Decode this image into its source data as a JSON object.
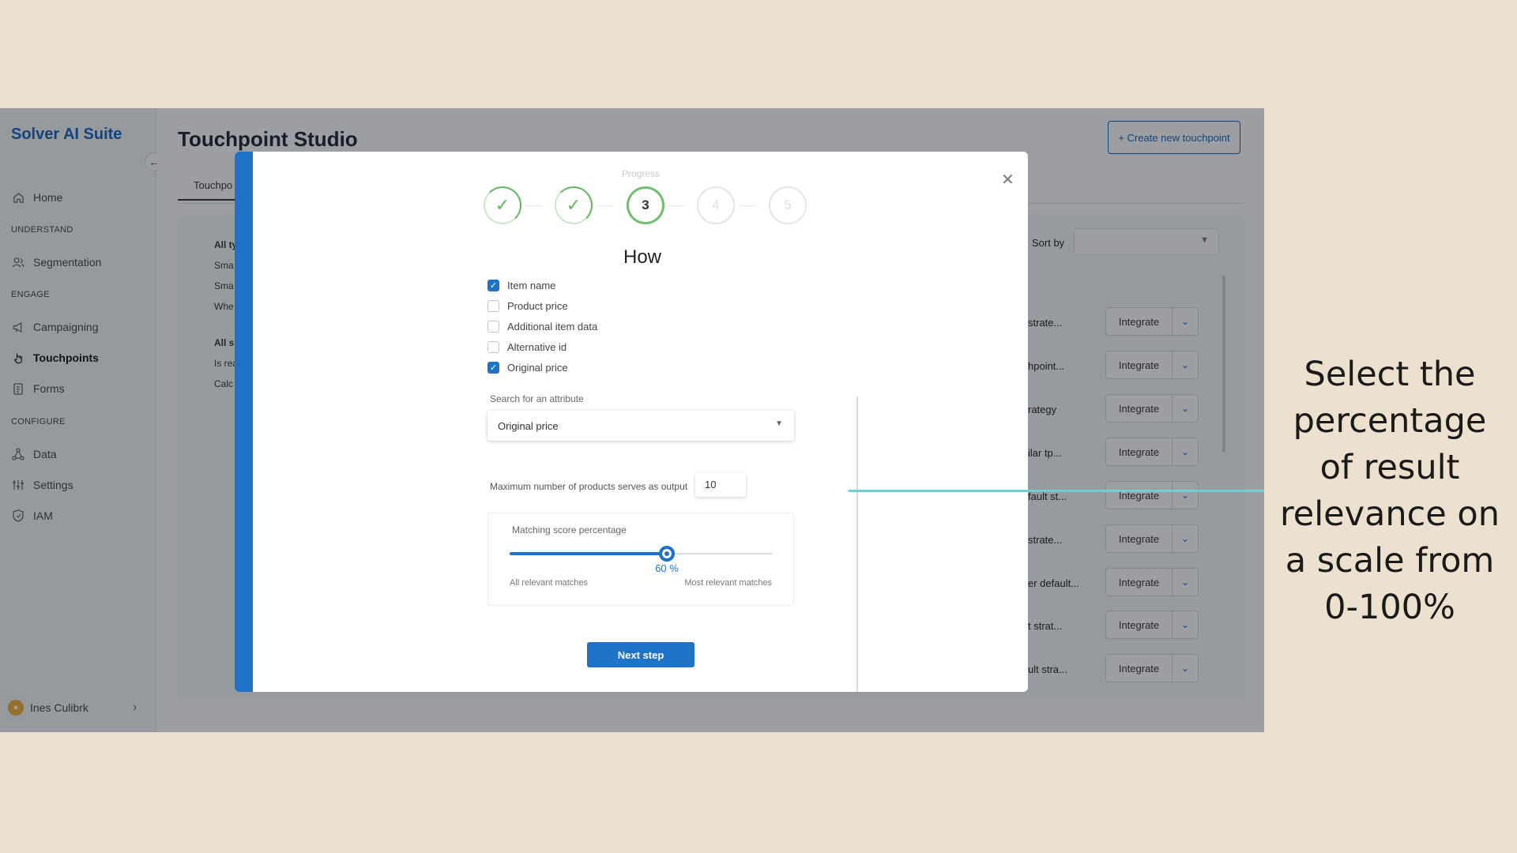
{
  "sidebar": {
    "brand": "Solver AI Suite",
    "collapse_icon": "arrow-left-icon",
    "items": [
      {
        "label": "Home",
        "icon": "home-icon"
      },
      {
        "section": "UNDERSTAND"
      },
      {
        "label": "Segmentation",
        "icon": "users-icon"
      },
      {
        "section": "ENGAGE"
      },
      {
        "label": "Campaigning",
        "icon": "megaphone-icon"
      },
      {
        "label": "Touchpoints",
        "icon": "pointer-hand-icon",
        "active": true
      },
      {
        "label": "Forms",
        "icon": "clipboard-icon"
      },
      {
        "section": "CONFIGURE"
      },
      {
        "label": "Data",
        "icon": "data-nodes-icon"
      },
      {
        "label": "Settings",
        "icon": "sliders-icon"
      },
      {
        "label": "IAM",
        "icon": "shield-icon"
      }
    ],
    "user": {
      "name": "Ines Culibrk",
      "icon": "user-icon"
    }
  },
  "main": {
    "title": "Touchpoint Studio",
    "create_button": "+ Create new touchpoint",
    "tab": "Touchpo",
    "left_texts": [
      {
        "text": "All ty",
        "bold": true
      },
      {
        "text": "Sma"
      },
      {
        "text": "Sma"
      },
      {
        "text": "Whe"
      },
      {
        "text": "All s",
        "bold": true
      },
      {
        "text": "Is rea"
      },
      {
        "text": "Calc"
      }
    ],
    "sort_by": "Sort by",
    "rows": [
      {
        "text": "strate...",
        "button": "Integrate"
      },
      {
        "text": "hpoint...",
        "button": "Integrate"
      },
      {
        "text": "rategy",
        "button": "Integrate"
      },
      {
        "text": "ilar tp...",
        "button": "Integrate"
      },
      {
        "text": "fault st...",
        "button": "Integrate"
      },
      {
        "text": "strate...",
        "button": "Integrate"
      },
      {
        "text": "er default...",
        "button": "Integrate"
      },
      {
        "text": "t strat...",
        "button": "Integrate"
      },
      {
        "text": "ult stra...",
        "button": "Integrate"
      }
    ]
  },
  "modal": {
    "progress_label": "Progress",
    "steps": [
      {
        "label": "",
        "state": "done"
      },
      {
        "label": "",
        "state": "done"
      },
      {
        "label": "3",
        "state": "current"
      },
      {
        "label": "4",
        "state": "pending"
      },
      {
        "label": "5",
        "state": "pending"
      }
    ],
    "heading": "How",
    "checkboxes": [
      {
        "label": "Item name",
        "checked": true
      },
      {
        "label": "Product price",
        "checked": false
      },
      {
        "label": "Additional item data",
        "checked": false
      },
      {
        "label": "Alternative id",
        "checked": false
      },
      {
        "label": "Original price",
        "checked": true
      }
    ],
    "search_label": "Search for an attribute",
    "selected_attribute": "Original price",
    "max_products_label": "Maximum number of products serves as output",
    "max_products_value": "10",
    "matching": {
      "title": "Matching score percentage",
      "value": 60,
      "value_text": "60 %",
      "min_label": "All relevant matches",
      "max_label": "Most relevant matches"
    },
    "next_button": "Next step",
    "close_icon": "close-icon"
  },
  "annotation": {
    "text": "Select the percentage of result relevance on a scale from 0-100%",
    "line_color": "#71d0cf"
  },
  "colors": {
    "primary": "#1e72c7",
    "success": "#5cb85c",
    "background": "#ece1cf"
  }
}
